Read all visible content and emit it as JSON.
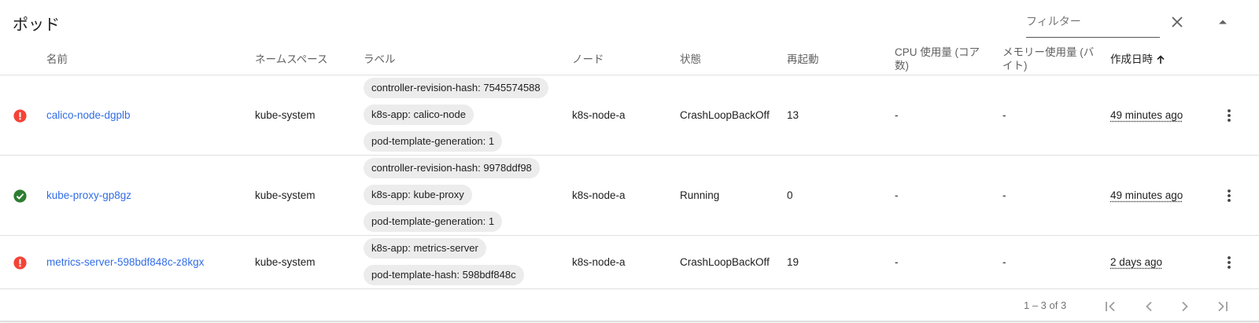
{
  "panel": {
    "title": "ポッド",
    "filter_placeholder": "フィルター"
  },
  "columns": {
    "name": "名前",
    "namespace": "ネームスペース",
    "labels": "ラベル",
    "node": "ノード",
    "status": "状態",
    "restarts": "再起動",
    "cpu": "CPU 使用量 (コア数)",
    "cpu_line1": "CPU 使用量 (コア",
    "cpu_line2": "数)",
    "memory": "メモリー使用量 (バイト)",
    "memory_line1": "メモリー使用量 (バ",
    "memory_line2": "イト)",
    "created": "作成日時",
    "sort_icon": "arrow-up-icon"
  },
  "rows": [
    {
      "status_icon": "error-icon",
      "name": "calico-node-dgplb",
      "namespace": "kube-system",
      "labels": [
        "controller-revision-hash: 7545574588",
        "k8s-app: calico-node",
        "pod-template-generation: 1"
      ],
      "node": "k8s-node-a",
      "status": "CrashLoopBackOff",
      "restarts": "13",
      "cpu": "-",
      "memory": "-",
      "created": "49 minutes ago"
    },
    {
      "status_icon": "check-circle-icon",
      "name": "kube-proxy-gp8gz",
      "namespace": "kube-system",
      "labels": [
        "controller-revision-hash: 9978ddf98",
        "k8s-app: kube-proxy",
        "pod-template-generation: 1"
      ],
      "node": "k8s-node-a",
      "status": "Running",
      "restarts": "0",
      "cpu": "-",
      "memory": "-",
      "created": "49 minutes ago"
    },
    {
      "status_icon": "error-icon",
      "name": "metrics-server-598bdf848c-z8kgx",
      "namespace": "kube-system",
      "labels": [
        "k8s-app: metrics-server",
        "pod-template-hash: 598bdf848c"
      ],
      "node": "k8s-node-a",
      "status": "CrashLoopBackOff",
      "restarts": "19",
      "cpu": "-",
      "memory": "-",
      "created": "2 days ago"
    }
  ],
  "pagination": {
    "range_label": "1 – 3 of 3"
  },
  "colors": {
    "error": "#f44336",
    "success": "#2e7d32",
    "link": "#326de6"
  }
}
